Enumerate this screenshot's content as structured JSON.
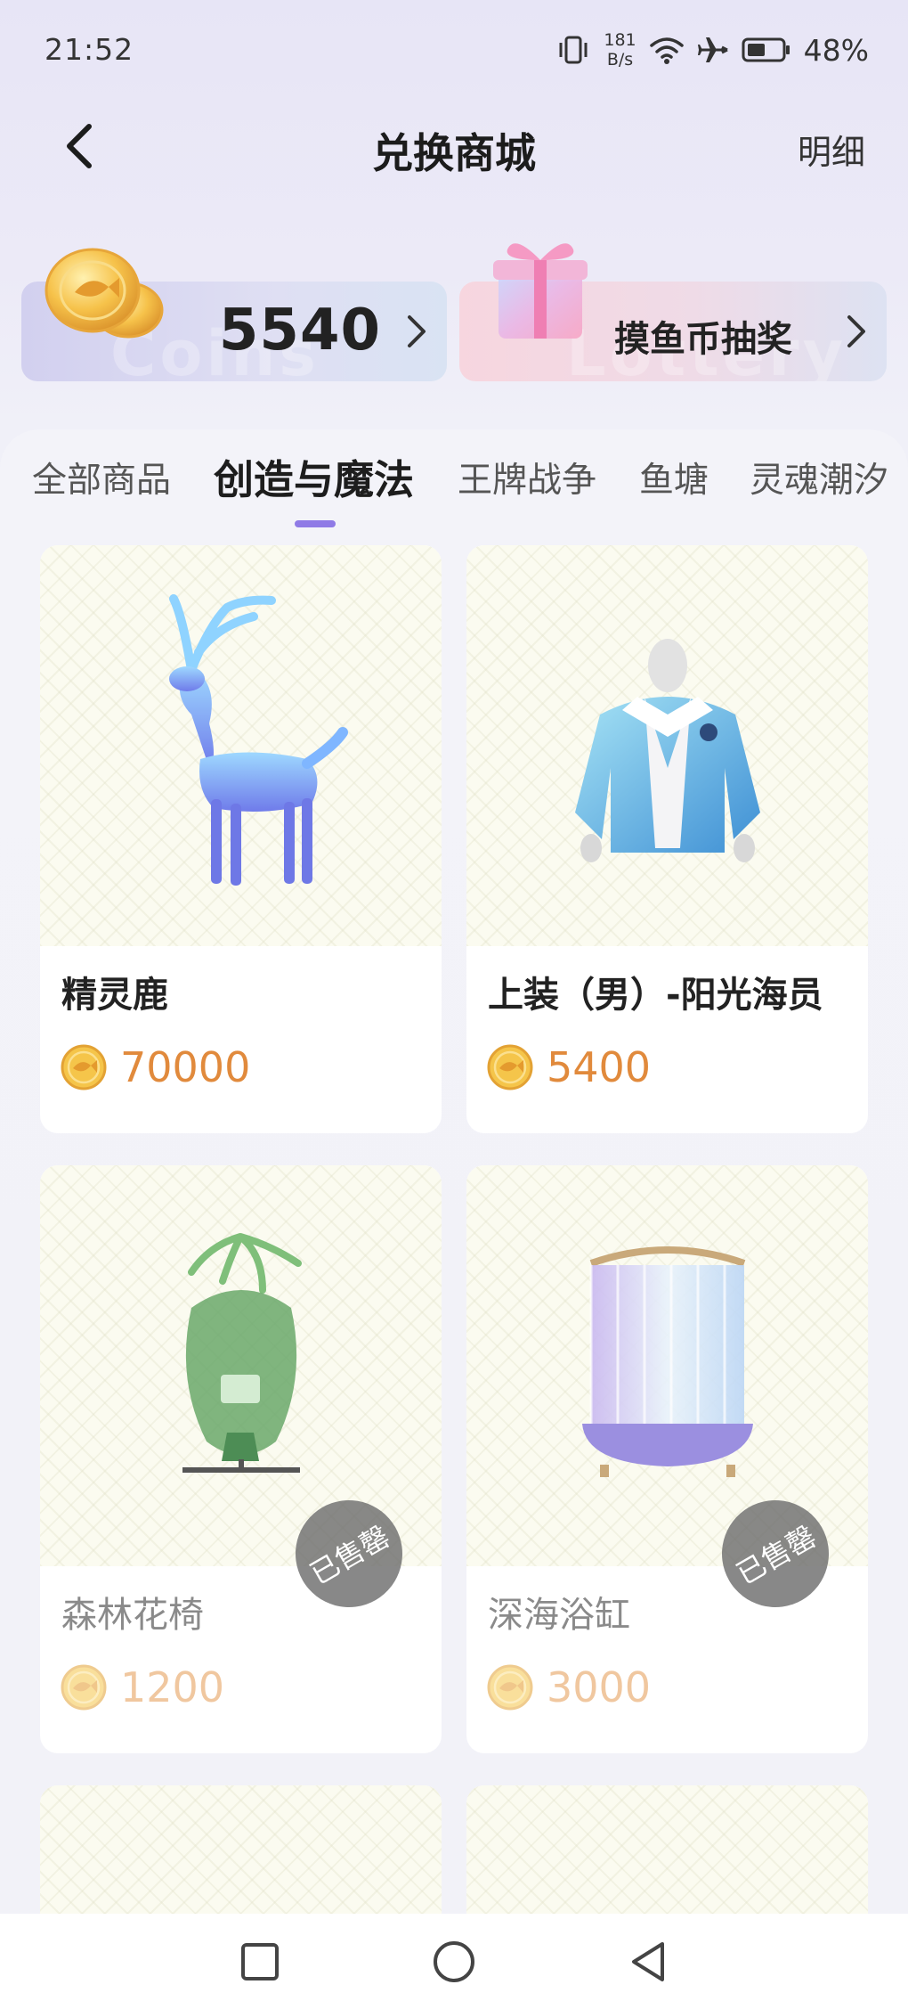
{
  "status_bar": {
    "time": "21:52",
    "net_speed_value": "181",
    "net_speed_unit": "B/s",
    "battery": "48%",
    "icons": [
      "vibrate-icon",
      "wifi-icon",
      "airplane-mode-icon",
      "battery-icon"
    ]
  },
  "header": {
    "title": "兑换商城",
    "detail": "明细",
    "back_icon": "chevron-left-icon"
  },
  "coin_card": {
    "balance": "5540",
    "watermark": "Coins",
    "icon": "fish-coin-stack-icon"
  },
  "lottery_card": {
    "label": "摸鱼币抽奖",
    "watermark": "Lottery",
    "icon": "gift-box-icon"
  },
  "tabs": [
    {
      "label": "全部商品",
      "active": false
    },
    {
      "label": "创造与魔法",
      "active": true
    },
    {
      "label": "王牌战争",
      "active": false
    },
    {
      "label": "鱼塘",
      "active": false
    },
    {
      "label": "灵魂潮汐",
      "active": false
    }
  ],
  "products": [
    {
      "name": "精灵鹿",
      "price": "70000",
      "sold_out": false,
      "image": "spirit-deer-image"
    },
    {
      "name": "上装（男）-阳光海员",
      "price": "5400",
      "sold_out": false,
      "image": "sailor-jacket-image"
    },
    {
      "name": "森林花椅",
      "price": "1200",
      "sold_out": true,
      "badge": "已售罄",
      "image": "forest-flower-chair-image"
    },
    {
      "name": "深海浴缸",
      "price": "3000",
      "sold_out": true,
      "badge": "已售罄",
      "image": "deep-sea-bathtub-image"
    }
  ],
  "colors": {
    "accent": "#8f7ae6",
    "price": "#e18a3c",
    "price_sold": "#f0c79f"
  },
  "nav_bar": {
    "buttons": [
      "recent-apps-icon",
      "home-icon",
      "back-triangle-icon"
    ]
  }
}
